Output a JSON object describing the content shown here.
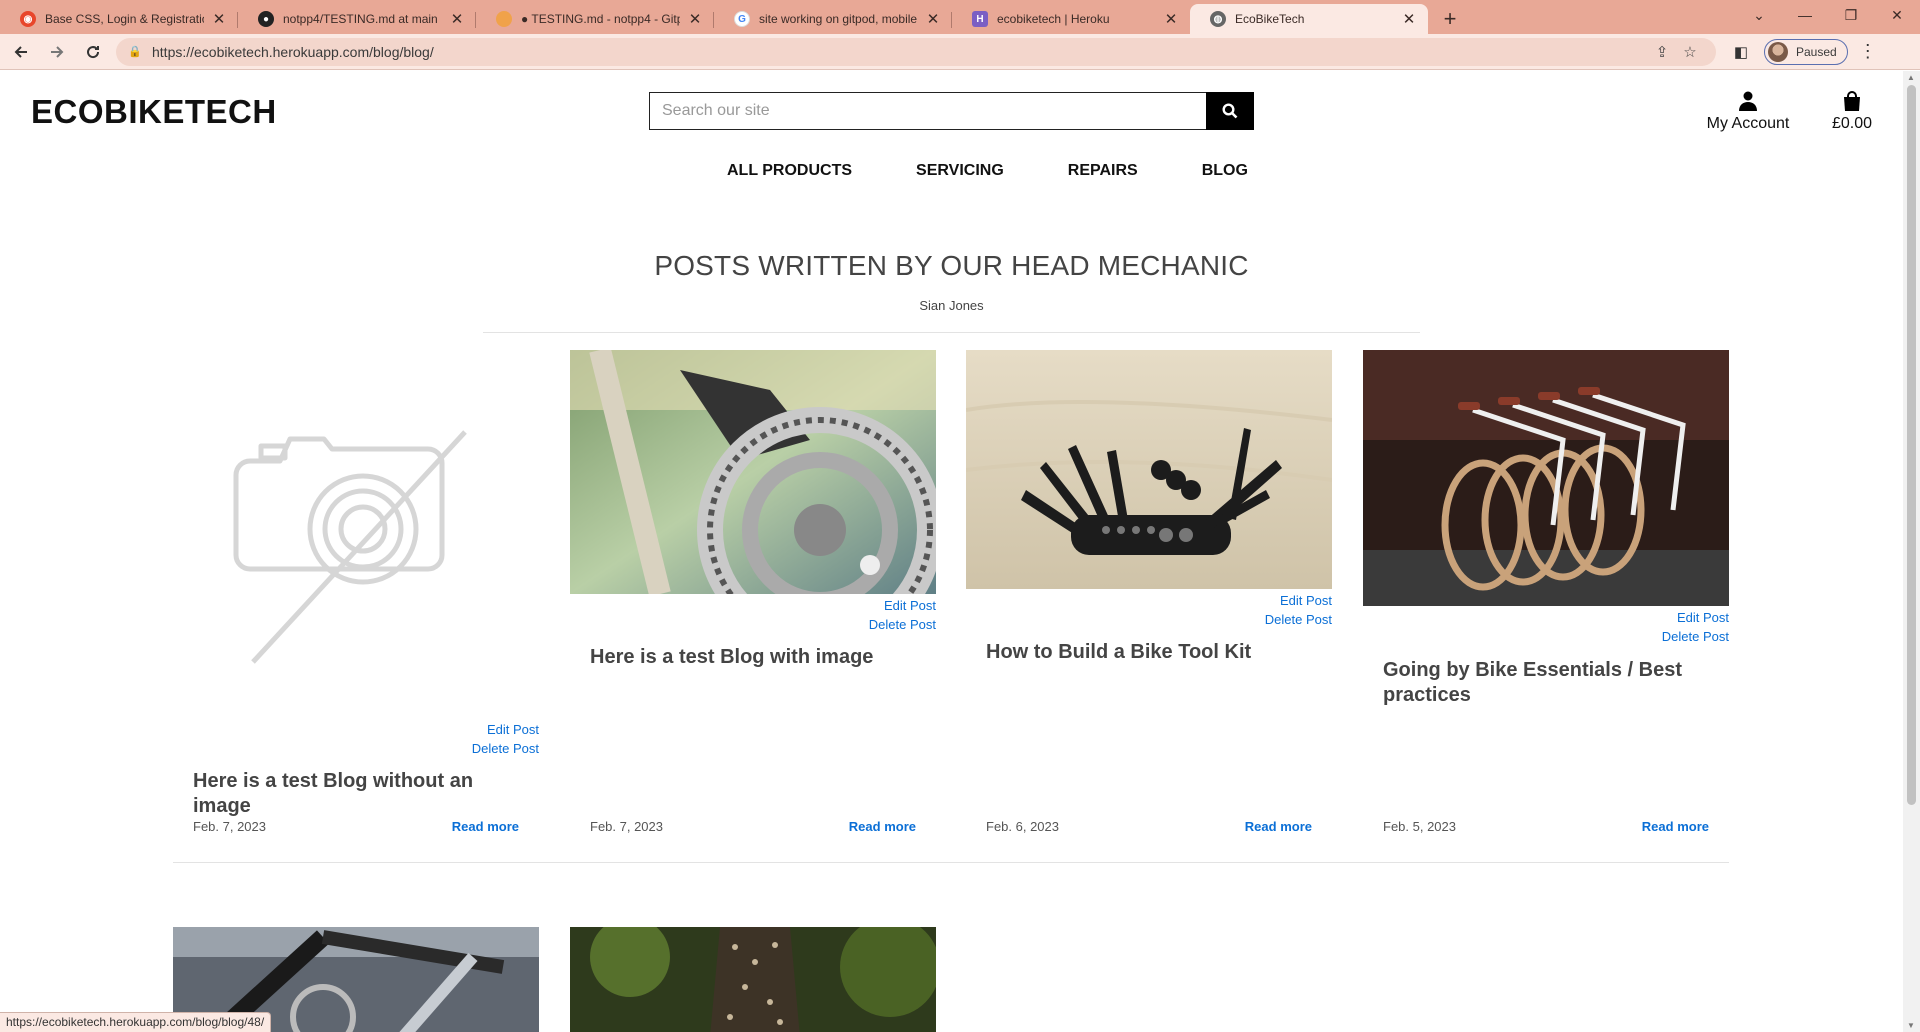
{
  "browser": {
    "tabs": [
      {
        "title": "Base CSS, Login & Registration R",
        "favicon": "codeinstitute-icon",
        "color": "#e8462b",
        "active": false
      },
      {
        "title": "notpp4/TESTING.md at main · ict",
        "favicon": "github-icon",
        "color": "#222222",
        "active": false
      },
      {
        "title": "● TESTING.md - notpp4 - Gitpod",
        "favicon": "gitpod-icon",
        "color": "#f0a24a",
        "active": false
      },
      {
        "title": "site working on gitpod, mobile b",
        "favicon": "google-icon",
        "color": "#4285f4",
        "active": false
      },
      {
        "title": "ecobiketech | Heroku",
        "favicon": "heroku-icon",
        "color": "#7b5fc4",
        "active": false
      },
      {
        "title": "EcoBikeTech",
        "favicon": "globe-icon",
        "color": "#555555",
        "active": true
      }
    ],
    "url": "https://ecobiketech.herokuapp.com/blog/blog/",
    "profile_label": "Paused",
    "status_url": "https://ecobiketech.herokuapp.com/blog/blog/48/"
  },
  "site": {
    "brand": "ECOBIKETECH",
    "search_placeholder": "Search our site",
    "account_label": "My Account",
    "bag_total": "£0.00",
    "nav": [
      "ALL PRODUCTS",
      "SERVICING",
      "REPAIRS",
      "BLOG"
    ]
  },
  "blog": {
    "heading": "POSTS WRITTEN BY OUR HEAD MECHANIC",
    "author": "Sian Jones",
    "edit_label": "Edit Post",
    "delete_label": "Delete Post",
    "read_more_label": "Read more",
    "posts": [
      {
        "title": "Here is a test Blog without an image",
        "date": "Feb. 7, 2023",
        "image": "no-image-placeholder"
      },
      {
        "title": "Here is a test Blog with image",
        "date": "Feb. 7, 2023",
        "image": "bike-chainring-photo"
      },
      {
        "title": "How to Build a Bike Tool Kit",
        "date": "Feb. 6, 2023",
        "image": "multi-tool-photo"
      },
      {
        "title": "Going by Bike Essentials / Best practices",
        "date": "Feb. 5, 2023",
        "image": "parked-bikes-photo"
      }
    ],
    "second_row": [
      {
        "image": "bike-frame-photo"
      },
      {
        "image": "cyclist-dress-photo"
      }
    ]
  }
}
